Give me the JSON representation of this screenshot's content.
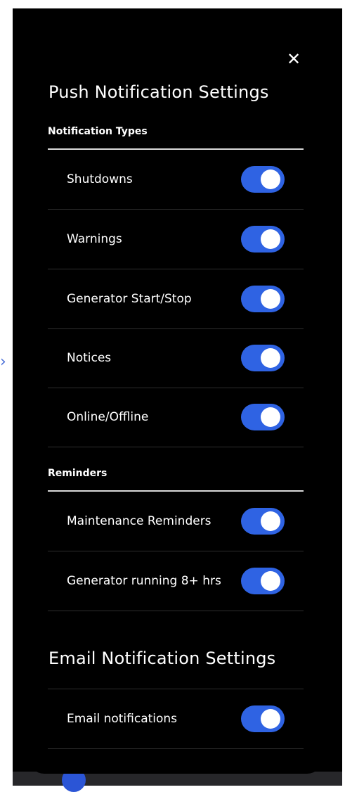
{
  "close_icon": "close-icon",
  "push": {
    "title": "Push Notification Settings",
    "sections": [
      {
        "heading": "Notification Types",
        "items": [
          {
            "label": "Shutdowns",
            "enabled": true
          },
          {
            "label": "Warnings",
            "enabled": true
          },
          {
            "label": "Generator Start/Stop",
            "enabled": true
          },
          {
            "label": "Notices",
            "enabled": true
          },
          {
            "label": "Online/Offline",
            "enabled": true
          }
        ]
      },
      {
        "heading": "Reminders",
        "items": [
          {
            "label": "Maintenance Reminders",
            "enabled": true
          },
          {
            "label": "Generator running 8+ hrs",
            "enabled": true
          }
        ]
      }
    ]
  },
  "email": {
    "title": "Email Notification Settings",
    "items": [
      {
        "label": "Email notifications",
        "enabled": true
      }
    ]
  },
  "colors": {
    "panel_bg": "#000000",
    "toggle_on": "#2f63e3",
    "divider": "#2e2e2e",
    "section_rule": "#d9d9d9"
  }
}
